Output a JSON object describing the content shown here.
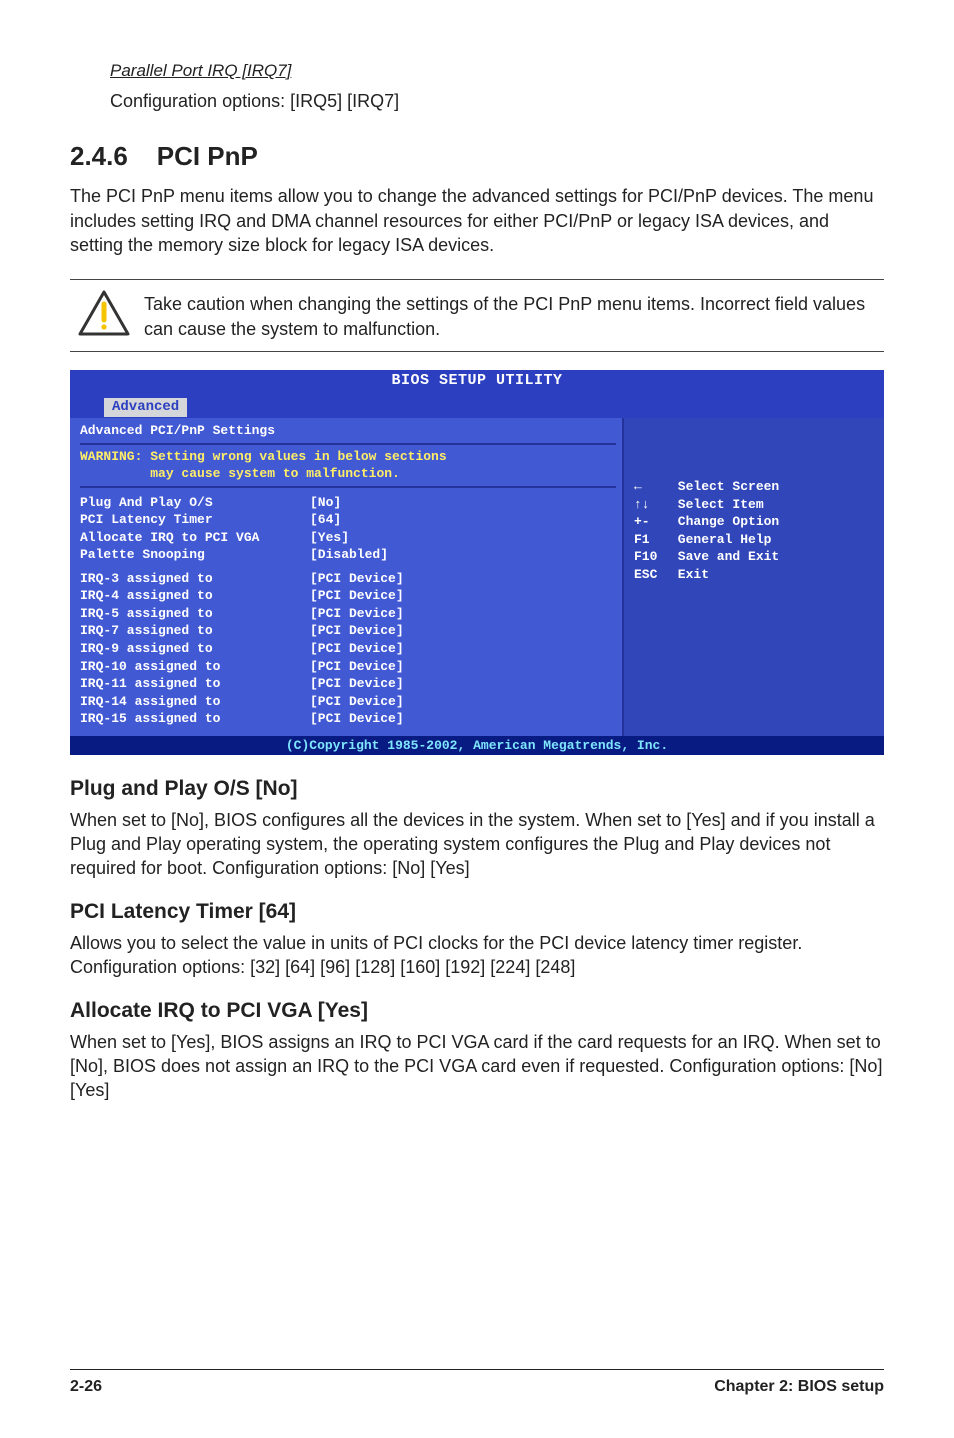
{
  "top": {
    "parallel_heading": "Parallel Port IRQ [IRQ7]",
    "parallel_options": "Configuration options: [IRQ5] [IRQ7]"
  },
  "section": {
    "number": "2.4.6",
    "title": "PCI PnP",
    "para": "The PCI PnP menu items allow you to change the advanced settings for PCI/PnP devices. The menu includes setting IRQ and DMA channel resources for either PCI/PnP or legacy ISA devices, and setting the memory size block for legacy ISA devices."
  },
  "note": {
    "text": "Take caution when changing the settings of the PCI PnP menu items. Incorrect field values can cause the system to malfunction."
  },
  "bios": {
    "header": "BIOS SETUP UTILITY",
    "tab": "Advanced",
    "panel_title": "Advanced PCI/PnP Settings",
    "warn1": "WARNING: Setting wrong values in below sections",
    "warn2": "         may cause system to malfunction.",
    "rows_a": [
      {
        "k": "Plug And Play O/S",
        "v": "[No]"
      },
      {
        "k": "PCI Latency Timer",
        "v": "[64]"
      },
      {
        "k": "Allocate IRQ to PCI VGA",
        "v": "[Yes]"
      },
      {
        "k": "Palette Snooping",
        "v": "[Disabled]"
      }
    ],
    "rows_b": [
      {
        "k": "IRQ-3 assigned to",
        "v": "[PCI Device]"
      },
      {
        "k": "IRQ-4 assigned to",
        "v": "[PCI Device]"
      },
      {
        "k": "IRQ-5 assigned to",
        "v": "[PCI Device]"
      },
      {
        "k": "IRQ-7 assigned to",
        "v": "[PCI Device]"
      },
      {
        "k": "IRQ-9 assigned to",
        "v": "[PCI Device]"
      },
      {
        "k": "IRQ-10 assigned to",
        "v": "[PCI Device]"
      },
      {
        "k": "IRQ-11 assigned to",
        "v": "[PCI Device]"
      },
      {
        "k": "IRQ-14 assigned to",
        "v": "[PCI Device]"
      },
      {
        "k": "IRQ-15 assigned to",
        "v": "[PCI Device]"
      }
    ],
    "help": [
      {
        "key": "←",
        "lbl": "Select Screen"
      },
      {
        "key": "↑↓",
        "lbl": "Select Item"
      },
      {
        "key": "+-",
        "lbl": "Change Option"
      },
      {
        "key": "F1",
        "lbl": "General Help"
      },
      {
        "key": "F10",
        "lbl": "Save and Exit"
      },
      {
        "key": "ESC",
        "lbl": "Exit"
      }
    ],
    "footer": "(C)Copyright 1985-2002, American Megatrends, Inc."
  },
  "subs": {
    "s1_h": "Plug and Play O/S [No]",
    "s1_p": "When set to [No], BIOS configures all the devices in the system. When set to [Yes] and if you install a Plug and Play operating system, the operating system configures the Plug and Play devices not required for boot. Configuration options: [No] [Yes]",
    "s2_h": "PCI Latency Timer [64]",
    "s2_p": "Allows you to select the value in units of PCI clocks for the PCI device latency timer register. Configuration options: [32] [64] [96] [128] [160] [192] [224] [248]",
    "s3_h": "Allocate IRQ to PCI VGA [Yes]",
    "s3_p": "When set to [Yes], BIOS assigns an IRQ to PCI VGA card if the card requests for an IRQ. When set to [No], BIOS does not assign an IRQ to the PCI VGA card even if requested. Configuration options: [No] [Yes]"
  },
  "footer": {
    "page": "2-26",
    "chapter": "Chapter 2: BIOS setup"
  }
}
